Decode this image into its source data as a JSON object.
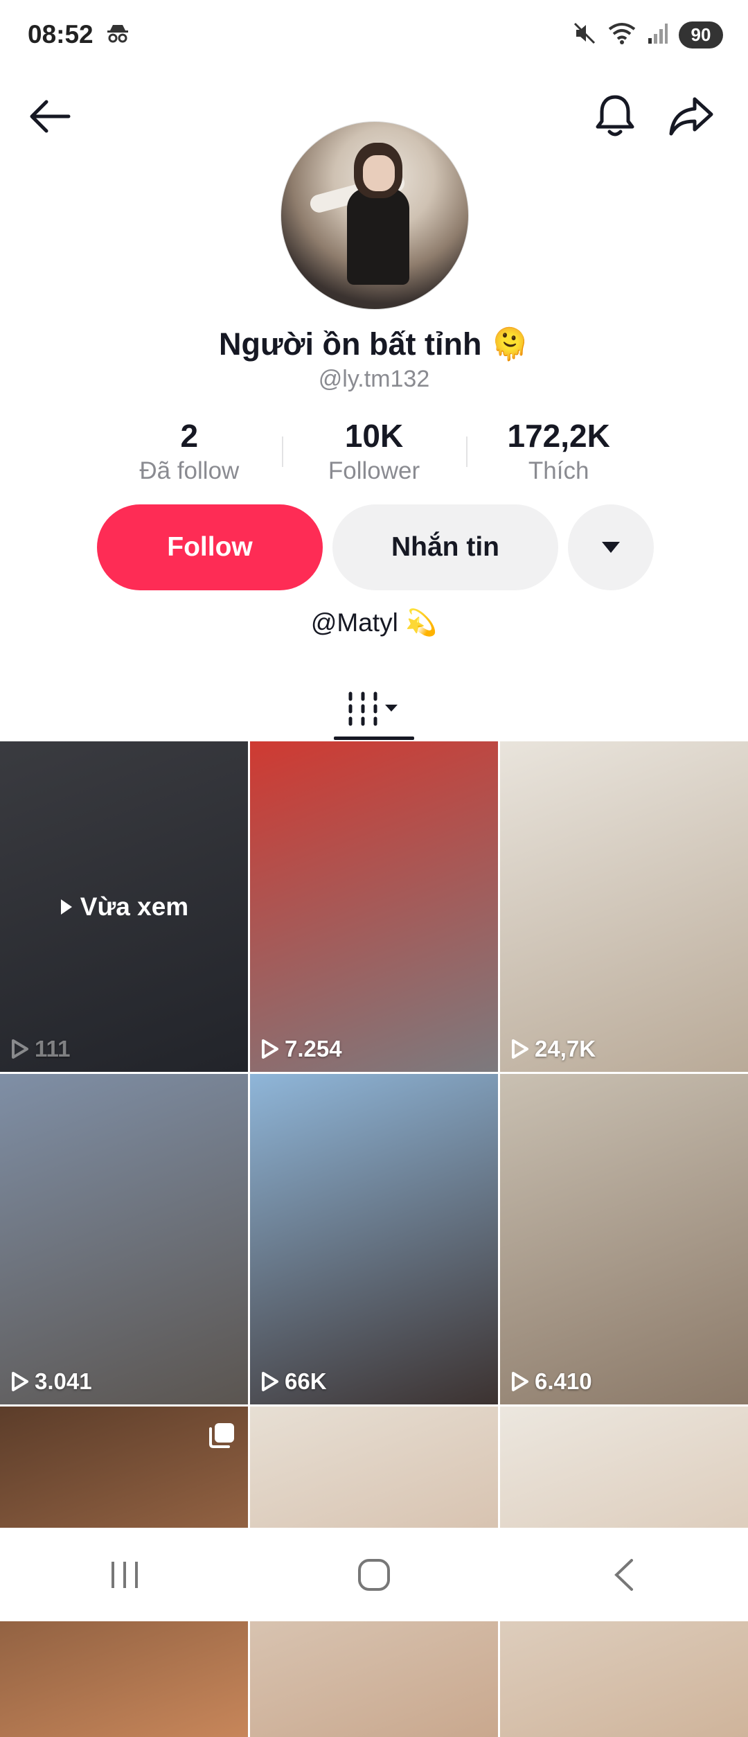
{
  "status_bar": {
    "time": "08:52",
    "battery": "90"
  },
  "profile": {
    "display_name": "Người ồn bất tỉnh 🫠",
    "handle": "@ly.tm132",
    "stats": [
      {
        "value": "2",
        "label": "Đã follow"
      },
      {
        "value": "10K",
        "label": "Follower"
      },
      {
        "value": "172,2K",
        "label": "Thích"
      }
    ],
    "bio": "@Matyl 💫"
  },
  "actions": {
    "follow_label": "Follow",
    "message_label": "Nhắn tin"
  },
  "grid": {
    "watched_label": "Vừa xem",
    "videos": [
      {
        "views": "111",
        "colors": [
          "#3a3b40",
          "#22242a"
        ]
      },
      {
        "views": "7.254",
        "colors": [
          "#cf3a32",
          "#7c7a7e"
        ]
      },
      {
        "views": "24,7K",
        "colors": [
          "#e9e4dc",
          "#b9aa98"
        ]
      },
      {
        "views": "3.041",
        "colors": [
          "#7f8fa6",
          "#5b5550"
        ]
      },
      {
        "views": "66K",
        "colors": [
          "#8fb6d9",
          "#3c3230"
        ]
      },
      {
        "views": "6.410",
        "colors": [
          "#c9c0b2",
          "#8b7968"
        ]
      },
      {
        "views": "",
        "colors": [
          "#5c3d2a",
          "#c7865a"
        ]
      },
      {
        "views": "",
        "colors": [
          "#e7dfd4",
          "#c9a88e"
        ]
      },
      {
        "views": "",
        "colors": [
          "#ece7df",
          "#cfb49b"
        ]
      }
    ]
  },
  "icons": {
    "back": "back-arrow-icon",
    "bell": "bell-icon",
    "share": "share-icon",
    "dropdown": "caret-down-icon",
    "grid_tab": "video-grid-icon"
  }
}
